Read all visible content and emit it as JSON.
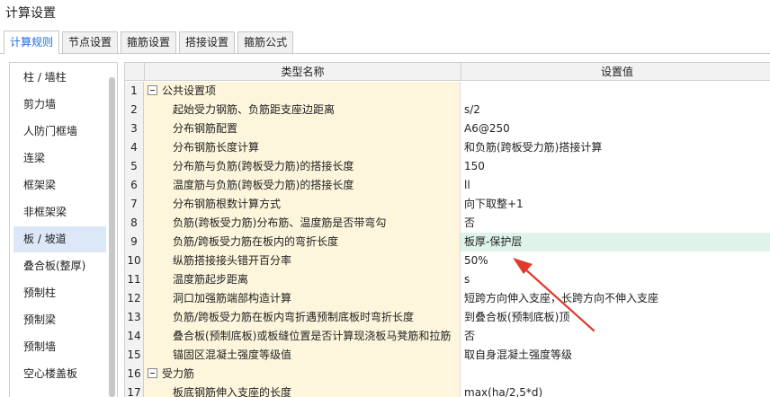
{
  "window": {
    "title": "计算设置"
  },
  "tabs": [
    {
      "label": "计算规则",
      "active": true
    },
    {
      "label": "节点设置",
      "active": false
    },
    {
      "label": "箍筋设置",
      "active": false
    },
    {
      "label": "搭接设置",
      "active": false
    },
    {
      "label": "箍筋公式",
      "active": false
    }
  ],
  "sidebar": {
    "items": [
      {
        "label": "柱 / 墙柱"
      },
      {
        "label": "剪力墙"
      },
      {
        "label": "人防门框墙"
      },
      {
        "label": "连梁"
      },
      {
        "label": "框架梁"
      },
      {
        "label": "非框架梁"
      },
      {
        "label": "板 / 坡道",
        "selected": true
      },
      {
        "label": "叠合板(整厚)"
      },
      {
        "label": "预制柱"
      },
      {
        "label": "预制梁"
      },
      {
        "label": "预制墙"
      },
      {
        "label": "空心楼盖板"
      }
    ]
  },
  "table": {
    "columns": {
      "name": "类型名称",
      "value": "设置值"
    },
    "rows": [
      {
        "num": "1",
        "name": "公共设置项",
        "value": "",
        "group": true
      },
      {
        "num": "2",
        "name": "起始受力钢筋、负筋距支座边距离",
        "value": "s/2"
      },
      {
        "num": "3",
        "name": "分布钢筋配置",
        "value": "A6@250"
      },
      {
        "num": "4",
        "name": "分布钢筋长度计算",
        "value": "和负筋(跨板受力筋)搭接计算"
      },
      {
        "num": "5",
        "name": "分布筋与负筋(跨板受力筋)的搭接长度",
        "value": "150"
      },
      {
        "num": "6",
        "name": "温度筋与负筋(跨板受力筋)的搭接长度",
        "value": "ll"
      },
      {
        "num": "7",
        "name": "分布钢筋根数计算方式",
        "value": "向下取整+1"
      },
      {
        "num": "8",
        "name": "负筋(跨板受力筋)分布筋、温度筋是否带弯勾",
        "value": "否"
      },
      {
        "num": "9",
        "name": "负筋/跨板受力筋在板内的弯折长度",
        "value": "板厚-保护层",
        "highlight": true
      },
      {
        "num": "10",
        "name": "纵筋搭接接头错开百分率",
        "value": "50%"
      },
      {
        "num": "11",
        "name": "温度筋起步距离",
        "value": "s"
      },
      {
        "num": "12",
        "name": "洞口加强筋端部构造计算",
        "value": "短跨方向伸入支座，长跨方向不伸入支座"
      },
      {
        "num": "13",
        "name": "负筋/跨板受力筋在板内弯折遇预制底板时弯折长度",
        "value": "到叠合板(预制底板)顶"
      },
      {
        "num": "14",
        "name": "叠合板(预制底板)或板缝位置是否计算现浇板马凳筋和拉筋",
        "value": "否"
      },
      {
        "num": "15",
        "name": "锚固区混凝土强度等级值",
        "value": "取自身混凝土强度等级"
      },
      {
        "num": "16",
        "name": "受力筋",
        "value": "",
        "group": true
      },
      {
        "num": "17",
        "name": "板底钢筋伸入支座的长度",
        "value": "max(ha/2,5*d)"
      }
    ]
  },
  "colors": {
    "accent": "#1e6fd9",
    "name_cell_bg": "#fdf6dc",
    "highlight_bg": "#dff3ea",
    "arrow": "#e03a2f"
  }
}
